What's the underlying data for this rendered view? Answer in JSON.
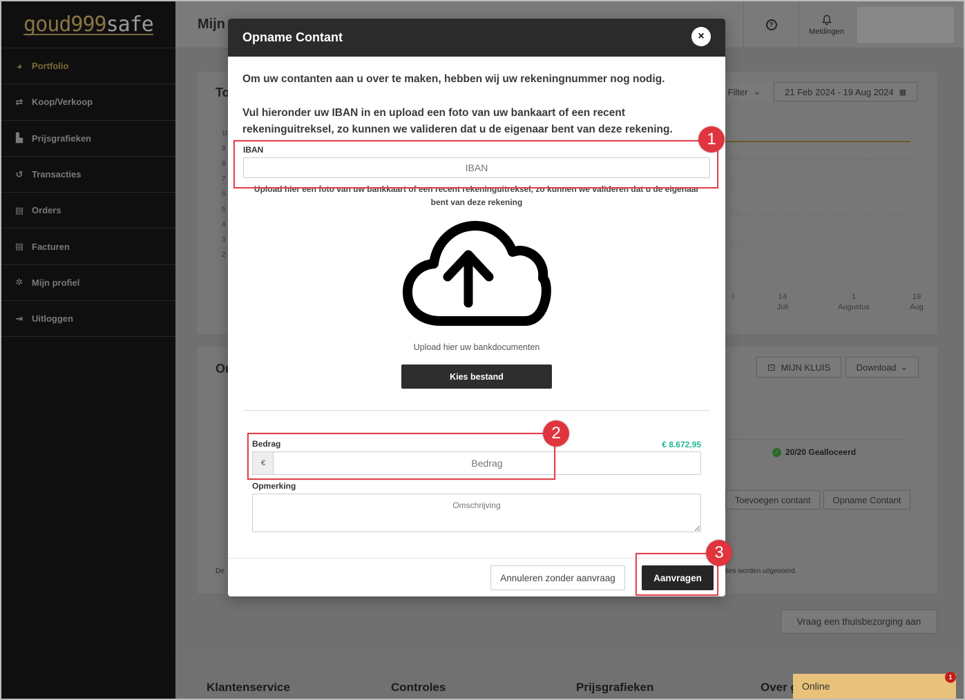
{
  "sidebar": {
    "logo_part1": "goud999",
    "logo_part2": "safe",
    "items": [
      {
        "label": "Portfolio",
        "icon": "pie-chart-icon",
        "glyph": "◕"
      },
      {
        "label": "Koop/Verkoop",
        "icon": "exchange-icon",
        "glyph": "⇄"
      },
      {
        "label": "Prijsgrafieken",
        "icon": "bar-chart-icon",
        "glyph": "▙"
      },
      {
        "label": "Transacties",
        "icon": "history-icon",
        "glyph": "↺"
      },
      {
        "label": "Orders",
        "icon": "document-icon",
        "glyph": "▤"
      },
      {
        "label": "Facturen",
        "icon": "invoice-icon",
        "glyph": "▤"
      },
      {
        "label": "Mijn profiel",
        "icon": "gear-icon",
        "glyph": "✲"
      },
      {
        "label": "Uitloggen",
        "icon": "logout-icon",
        "glyph": "⇥"
      }
    ]
  },
  "topbar": {
    "title": "Mijn",
    "help_glyph": "?",
    "notifications_label": "Meldingen"
  },
  "card1": {
    "title": "To",
    "filter_label": "Filter",
    "date_range": "21 Feb 2024 - 19 Aug 2024",
    "y_ticks": [
      "10",
      "9",
      "8",
      "7",
      "6",
      "5",
      "4",
      "3",
      "2"
    ],
    "x_ticks": [
      {
        "day": "",
        "month": "i"
      },
      {
        "day": "14",
        "month": "Juli"
      },
      {
        "day": "1",
        "month": "Augustus"
      },
      {
        "day": "19",
        "month": "Aug"
      }
    ]
  },
  "card2": {
    "title": "Or",
    "vault_label": "MIJN KLUIS",
    "download_label": "Download",
    "allocation": "20/20 Gealloceerd",
    "add_cash_label": "Toevoegen contant",
    "withdraw_cash_label": "Opname Contant",
    "footnote_left": "De",
    "footnote_right": "ties worden uitgevoerd."
  },
  "delivery_button": "Vraag een thuisbezorging aan",
  "footer": {
    "headings": [
      "Klantenservice",
      "Controles",
      "Prijsgrafieken",
      "Over g"
    ]
  },
  "chat": {
    "label": "Online",
    "badge": "1"
  },
  "modal": {
    "title": "Opname Contant",
    "close_glyph": "×",
    "intro_1": "Om uw contanten aan u over te maken, hebben wij uw rekeningnummer nog nodig.",
    "intro_2": "Vul hieronder uw IBAN in en upload een foto van uw bankaart of een recent rekeninguitreksel, zo kunnen we valideren dat u de eigenaar bent van deze rekening.",
    "iban_label": "IBAN",
    "iban_placeholder": "IBAN",
    "upload_help": "Upload hier een foto van uw bankkaart of een recent rekeninguitreksel, zo kunnen we valideren dat u de eigenaar bent van deze rekening",
    "upload_caption": "Upload hier uw bankdocumenten",
    "choose_file": "Kies bestand",
    "amount_label": "Bedrag",
    "available_balance": "€ 8.672,95",
    "currency": "€",
    "amount_placeholder": "Bedrag",
    "remark_label": "Opmerking",
    "remark_placeholder": "Omschrijving",
    "cancel_label": "Annuleren zonder aanvraag",
    "submit_label": "Aanvragen"
  },
  "annotations": {
    "step1": "1",
    "step2": "2",
    "step3": "3"
  },
  "colors": {
    "accent_gold": "#8a7543",
    "balance_green": "#1cb88e",
    "annotation_red": "#e0414a"
  }
}
